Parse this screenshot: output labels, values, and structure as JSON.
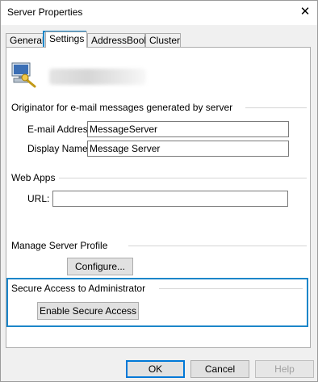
{
  "window": {
    "title": "Server Properties",
    "close_glyph": "✕"
  },
  "tabs": [
    {
      "label": "General",
      "active": false
    },
    {
      "label": "Settings",
      "active": true
    },
    {
      "label": "AddressBook",
      "active": false
    },
    {
      "label": "Cluster",
      "active": false
    }
  ],
  "server": {
    "icon": "server-computer-icon"
  },
  "originator": {
    "group_label": "Originator for e-mail messages generated by server",
    "email_label": "E-mail Address:",
    "email_value": "MessageServer",
    "display_label": "Display Name:",
    "display_value": "Message Server"
  },
  "web_apps": {
    "group_label": "Web Apps",
    "url_label": "URL:",
    "url_value": ""
  },
  "profile": {
    "label": "Manage Server Profile",
    "configure_button": "Configure..."
  },
  "secure_access": {
    "group_label": "Secure Access to Administrator",
    "enable_button": "Enable Secure Access"
  },
  "footer": {
    "ok": "OK",
    "cancel": "Cancel",
    "help": "Help"
  },
  "colors": {
    "highlight": "#1c86c9",
    "focus": "#0078d7"
  }
}
